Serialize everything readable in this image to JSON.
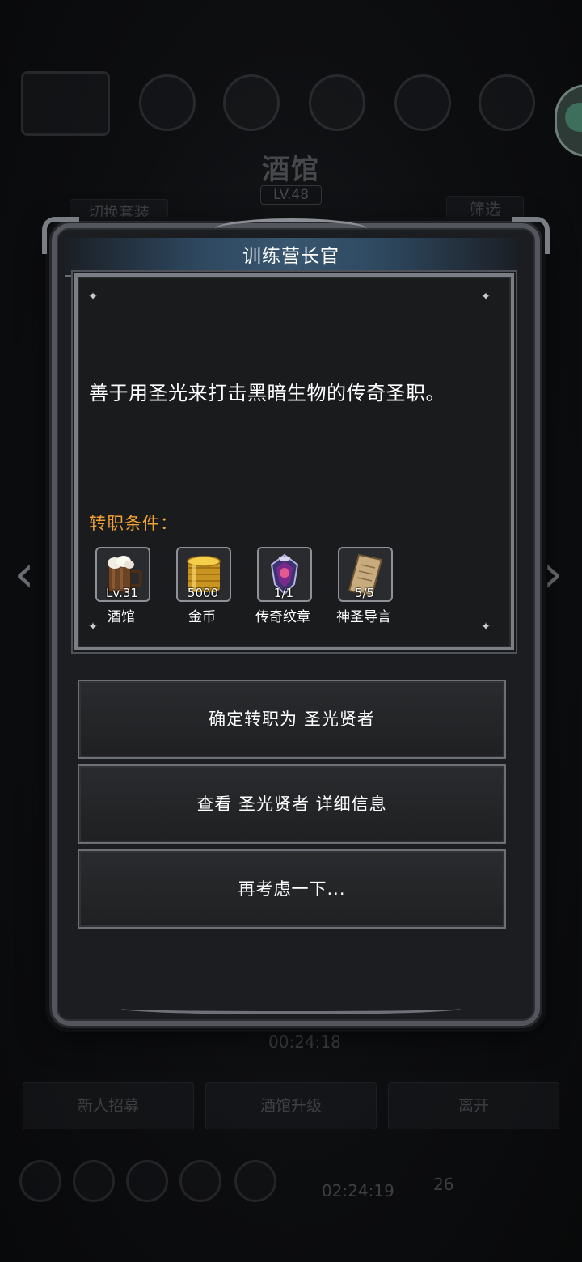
{
  "background": {
    "title": "酒馆",
    "level": "LV.48",
    "switch_outfit_button": "切换套装",
    "filter_button": "筛选",
    "timer_1": "00:24:18",
    "buttons": [
      "新人招募",
      "酒馆升级",
      "离开"
    ],
    "timer_2": "02:24:19",
    "gem_count": "26"
  },
  "dialog": {
    "title": "训练营长官",
    "description": "善于用圣光来打击黑暗生物的传奇圣职。",
    "conditions_label": "转职条件：",
    "requirements": [
      {
        "icon": "beer-mug-icon",
        "value": "Lv.31",
        "name": "酒馆"
      },
      {
        "icon": "gold-coins-icon",
        "value": "5000",
        "name": "金币"
      },
      {
        "icon": "legendary-emblem-icon",
        "value": "1/1",
        "name": "传奇纹章"
      },
      {
        "icon": "scroll-icon",
        "value": "5/5",
        "name": "神圣导言"
      }
    ],
    "actions": {
      "confirm": "确定转职为 圣光贤者",
      "details": "查看 圣光贤者 详细信息",
      "reconsider": "再考虑一下..."
    }
  }
}
